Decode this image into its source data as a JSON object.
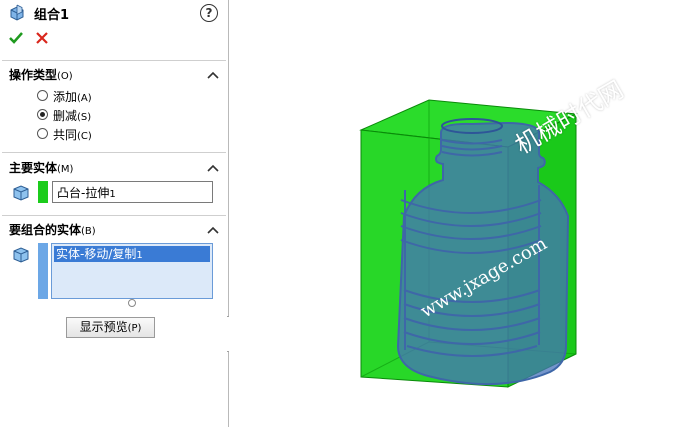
{
  "feature": {
    "title": "组合1",
    "help_glyph": "?",
    "ok_icon": "check-icon",
    "cancel_icon": "close-icon"
  },
  "operation": {
    "title": "操作类型",
    "title_key": "(O)",
    "options": [
      {
        "label": "添加",
        "key": "(A)",
        "selected": false
      },
      {
        "label": "删减",
        "key": "(S)",
        "selected": true
      },
      {
        "label": "共同",
        "key": "(C)",
        "selected": false
      }
    ]
  },
  "main_body": {
    "title": "主要实体",
    "title_key": "(M)",
    "value": "凸台-拉伸",
    "value_suffix": "1"
  },
  "bodies_to_combine": {
    "title": "要组合的实体",
    "title_key": "(B)",
    "items": [
      {
        "label": "实体-移动/复制",
        "suffix": "1"
      }
    ]
  },
  "preview_button": {
    "label": "显示预览",
    "key": "(P)"
  },
  "watermark": {
    "line1": "机械时代网",
    "line2": "www.jxage.com"
  },
  "colors": {
    "main_body": "#1ccc1c",
    "tool_body": "#4a74b8",
    "selection": "#3a7bd5"
  }
}
